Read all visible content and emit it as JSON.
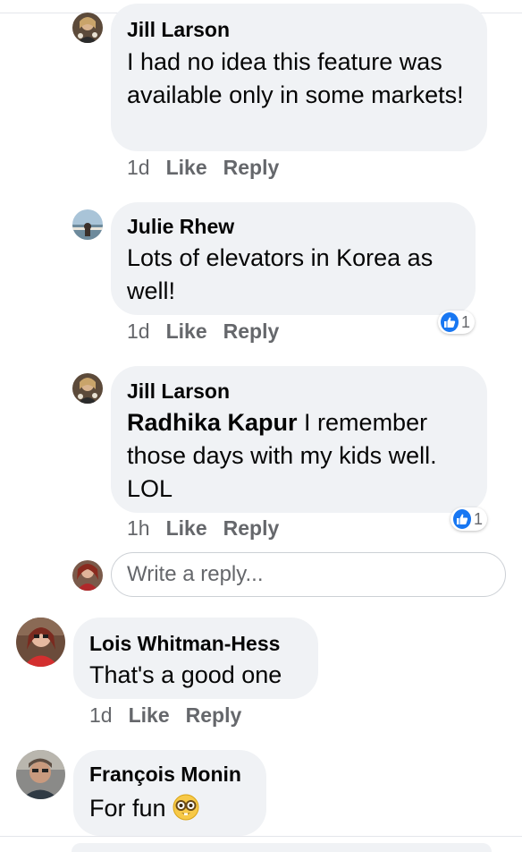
{
  "comments": [
    {
      "author": "Jill Larson",
      "text": "I had no idea this feature was available only in some markets!",
      "time": "1d",
      "like": "Like",
      "reply": "Reply"
    },
    {
      "author": "Julie Rhew",
      "text": "Lots of elevators in Korea as well!",
      "time": "1d",
      "like": "Like",
      "reply": "Reply",
      "reaction_count": "1"
    },
    {
      "author": "Jill Larson",
      "mention": "Radhika Kapur",
      "text": " I remember those days with my kids well. LOL",
      "time": "1h",
      "like": "Like",
      "reply": "Reply",
      "reaction_count": "1"
    },
    {
      "author": "Lois Whitman-Hess",
      "text": "That's a good one",
      "time": "1d",
      "like": "Like",
      "reply": "Reply"
    },
    {
      "author": "François Monin",
      "text": "For fun"
    }
  ],
  "reply_box": {
    "placeholder": "Write a reply..."
  },
  "colors": {
    "bubble": "#f0f2f5",
    "meta_text": "#65676b",
    "like_blue": "#1877f2"
  },
  "icons": [
    "like-reaction-icon",
    "nerd-face-emoji"
  ]
}
